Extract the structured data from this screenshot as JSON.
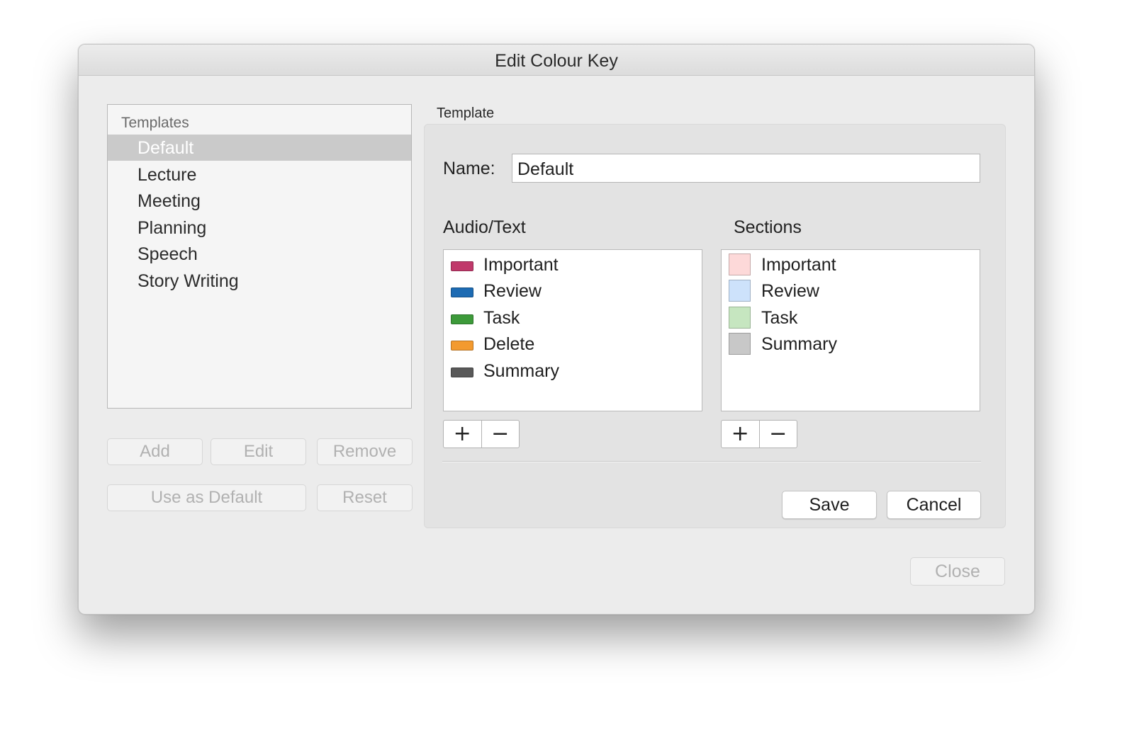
{
  "window": {
    "title": "Edit Colour Key"
  },
  "templates": {
    "header": "Templates",
    "items": [
      {
        "label": "Default",
        "selected": true
      },
      {
        "label": "Lecture",
        "selected": false
      },
      {
        "label": "Meeting",
        "selected": false
      },
      {
        "label": "Planning",
        "selected": false
      },
      {
        "label": "Speech",
        "selected": false
      },
      {
        "label": "Story Writing",
        "selected": false
      }
    ]
  },
  "left_buttons": {
    "add": "Add",
    "edit": "Edit",
    "remove": "Remove",
    "use_as_default": "Use as Default",
    "reset": "Reset"
  },
  "template_group": {
    "label": "Template",
    "name_label": "Name:",
    "name_value": "Default",
    "audio_text": {
      "heading": "Audio/Text",
      "items": [
        {
          "label": "Important",
          "color": "#c0396b"
        },
        {
          "label": "Review",
          "color": "#1d6bb3"
        },
        {
          "label": "Task",
          "color": "#3d9a3a"
        },
        {
          "label": "Delete",
          "color": "#f39a2f"
        },
        {
          "label": "Summary",
          "color": "#595959"
        }
      ]
    },
    "sections": {
      "heading": "Sections",
      "items": [
        {
          "label": "Important",
          "color": "#fdd9d9"
        },
        {
          "label": "Review",
          "color": "#cde2fb"
        },
        {
          "label": "Task",
          "color": "#c6e6c0"
        },
        {
          "label": "Summary",
          "color": "#c8c8c8"
        }
      ]
    },
    "plus_symbol": "+",
    "minus_symbol": "−",
    "save": "Save",
    "cancel": "Cancel"
  },
  "close": "Close"
}
